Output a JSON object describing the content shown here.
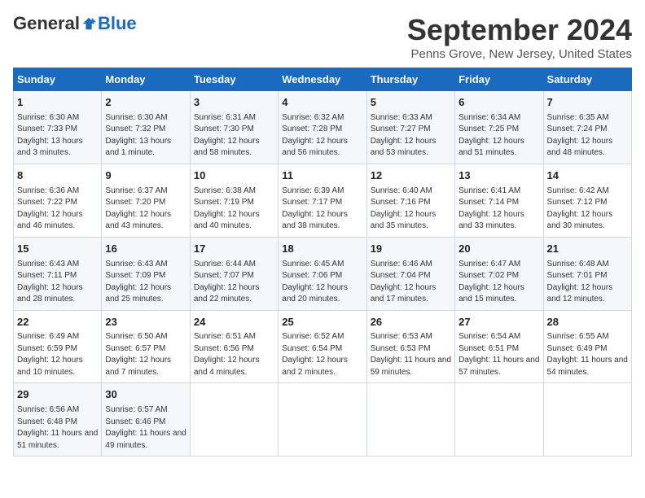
{
  "header": {
    "logo": {
      "general": "General",
      "blue": "Blue"
    },
    "title": "September 2024",
    "subtitle": "Penns Grove, New Jersey, United States"
  },
  "weekdays": [
    "Sunday",
    "Monday",
    "Tuesday",
    "Wednesday",
    "Thursday",
    "Friday",
    "Saturday"
  ],
  "weeks": [
    [
      {
        "day": "1",
        "info": "Sunrise: 6:30 AM\nSunset: 7:33 PM\nDaylight: 13 hours and 3 minutes."
      },
      {
        "day": "2",
        "info": "Sunrise: 6:30 AM\nSunset: 7:32 PM\nDaylight: 13 hours and 1 minute."
      },
      {
        "day": "3",
        "info": "Sunrise: 6:31 AM\nSunset: 7:30 PM\nDaylight: 12 hours and 58 minutes."
      },
      {
        "day": "4",
        "info": "Sunrise: 6:32 AM\nSunset: 7:28 PM\nDaylight: 12 hours and 56 minutes."
      },
      {
        "day": "5",
        "info": "Sunrise: 6:33 AM\nSunset: 7:27 PM\nDaylight: 12 hours and 53 minutes."
      },
      {
        "day": "6",
        "info": "Sunrise: 6:34 AM\nSunset: 7:25 PM\nDaylight: 12 hours and 51 minutes."
      },
      {
        "day": "7",
        "info": "Sunrise: 6:35 AM\nSunset: 7:24 PM\nDaylight: 12 hours and 48 minutes."
      }
    ],
    [
      {
        "day": "8",
        "info": "Sunrise: 6:36 AM\nSunset: 7:22 PM\nDaylight: 12 hours and 46 minutes."
      },
      {
        "day": "9",
        "info": "Sunrise: 6:37 AM\nSunset: 7:20 PM\nDaylight: 12 hours and 43 minutes."
      },
      {
        "day": "10",
        "info": "Sunrise: 6:38 AM\nSunset: 7:19 PM\nDaylight: 12 hours and 40 minutes."
      },
      {
        "day": "11",
        "info": "Sunrise: 6:39 AM\nSunset: 7:17 PM\nDaylight: 12 hours and 38 minutes."
      },
      {
        "day": "12",
        "info": "Sunrise: 6:40 AM\nSunset: 7:16 PM\nDaylight: 12 hours and 35 minutes."
      },
      {
        "day": "13",
        "info": "Sunrise: 6:41 AM\nSunset: 7:14 PM\nDaylight: 12 hours and 33 minutes."
      },
      {
        "day": "14",
        "info": "Sunrise: 6:42 AM\nSunset: 7:12 PM\nDaylight: 12 hours and 30 minutes."
      }
    ],
    [
      {
        "day": "15",
        "info": "Sunrise: 6:43 AM\nSunset: 7:11 PM\nDaylight: 12 hours and 28 minutes."
      },
      {
        "day": "16",
        "info": "Sunrise: 6:43 AM\nSunset: 7:09 PM\nDaylight: 12 hours and 25 minutes."
      },
      {
        "day": "17",
        "info": "Sunrise: 6:44 AM\nSunset: 7:07 PM\nDaylight: 12 hours and 22 minutes."
      },
      {
        "day": "18",
        "info": "Sunrise: 6:45 AM\nSunset: 7:06 PM\nDaylight: 12 hours and 20 minutes."
      },
      {
        "day": "19",
        "info": "Sunrise: 6:46 AM\nSunset: 7:04 PM\nDaylight: 12 hours and 17 minutes."
      },
      {
        "day": "20",
        "info": "Sunrise: 6:47 AM\nSunset: 7:02 PM\nDaylight: 12 hours and 15 minutes."
      },
      {
        "day": "21",
        "info": "Sunrise: 6:48 AM\nSunset: 7:01 PM\nDaylight: 12 hours and 12 minutes."
      }
    ],
    [
      {
        "day": "22",
        "info": "Sunrise: 6:49 AM\nSunset: 6:59 PM\nDaylight: 12 hours and 10 minutes."
      },
      {
        "day": "23",
        "info": "Sunrise: 6:50 AM\nSunset: 6:57 PM\nDaylight: 12 hours and 7 minutes."
      },
      {
        "day": "24",
        "info": "Sunrise: 6:51 AM\nSunset: 6:56 PM\nDaylight: 12 hours and 4 minutes."
      },
      {
        "day": "25",
        "info": "Sunrise: 6:52 AM\nSunset: 6:54 PM\nDaylight: 12 hours and 2 minutes."
      },
      {
        "day": "26",
        "info": "Sunrise: 6:53 AM\nSunset: 6:53 PM\nDaylight: 11 hours and 59 minutes."
      },
      {
        "day": "27",
        "info": "Sunrise: 6:54 AM\nSunset: 6:51 PM\nDaylight: 11 hours and 57 minutes."
      },
      {
        "day": "28",
        "info": "Sunrise: 6:55 AM\nSunset: 6:49 PM\nDaylight: 11 hours and 54 minutes."
      }
    ],
    [
      {
        "day": "29",
        "info": "Sunrise: 6:56 AM\nSunset: 6:48 PM\nDaylight: 11 hours and 51 minutes."
      },
      {
        "day": "30",
        "info": "Sunrise: 6:57 AM\nSunset: 6:46 PM\nDaylight: 11 hours and 49 minutes."
      },
      null,
      null,
      null,
      null,
      null
    ]
  ]
}
